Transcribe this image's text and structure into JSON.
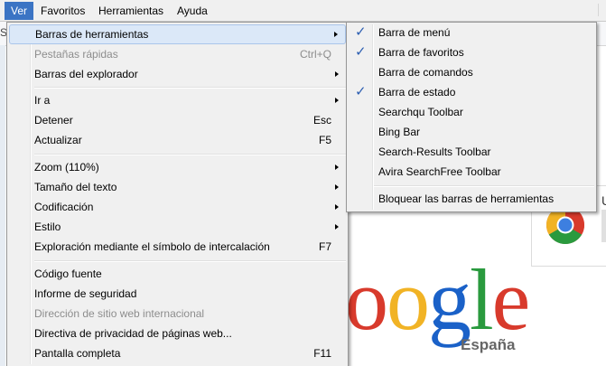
{
  "menubar": {
    "items": [
      {
        "label": "Ver",
        "active": true
      },
      {
        "label": "Favoritos",
        "active": false
      },
      {
        "label": "Herramientas",
        "active": false
      },
      {
        "label": "Ayuda",
        "active": false
      }
    ]
  },
  "ver_menu": {
    "items": [
      {
        "label": "Barras de herramientas",
        "submenu": true,
        "highlighted": true
      },
      {
        "label": "Pestañas rápidas",
        "shortcut": "Ctrl+Q",
        "disabled": true
      },
      {
        "label": "Barras del explorador",
        "submenu": true
      },
      {
        "label": "Ir a",
        "submenu": true
      },
      {
        "label": "Detener",
        "shortcut": "Esc"
      },
      {
        "label": "Actualizar",
        "shortcut": "F5"
      },
      {
        "label": "Zoom (110%)",
        "submenu": true
      },
      {
        "label": "Tamaño del texto",
        "submenu": true
      },
      {
        "label": "Codificación",
        "submenu": true
      },
      {
        "label": "Estilo",
        "submenu": true
      },
      {
        "label": "Exploración mediante el símbolo de intercalación",
        "shortcut": "F7"
      },
      {
        "label": "Código fuente"
      },
      {
        "label": "Informe de seguridad"
      },
      {
        "label": "Dirección de sitio web internacional",
        "disabled": true
      },
      {
        "label": "Directiva de privacidad de páginas web..."
      },
      {
        "label": "Pantalla completa",
        "shortcut": "F11"
      }
    ]
  },
  "toolbars_submenu": {
    "items": [
      {
        "label": "Barra de menú",
        "checked": true
      },
      {
        "label": "Barra de favoritos",
        "checked": true
      },
      {
        "label": "Barra de comandos",
        "checked": false
      },
      {
        "label": "Barra de estado",
        "checked": true
      },
      {
        "label": "Searchqu Toolbar",
        "checked": false
      },
      {
        "label": "Bing Bar",
        "checked": false
      },
      {
        "label": "Search-Results Toolbar",
        "checked": false
      },
      {
        "label": "Avira SearchFree Toolbar",
        "checked": false
      },
      {
        "label": "Bloquear las barras de herramientas",
        "checked": false
      }
    ],
    "check_glyph": "✓"
  },
  "background_page": {
    "partial_left_text": "S",
    "card_partial_letter": "U",
    "logo_letters": [
      "o",
      "o",
      "g",
      "l",
      "e"
    ],
    "logo_sub": "España",
    "colors": {
      "menu_bg": "#f0f0f0",
      "menubar_active": "#3b74c4",
      "highlight": "#dbe8f8",
      "check": "#2d5fb2",
      "google_blue": "#1a61c8",
      "google_red": "#d83a2c",
      "google_yellow": "#f1b325",
      "google_green": "#2a9a3e"
    },
    "icons": [
      "chrome-icon"
    ]
  }
}
